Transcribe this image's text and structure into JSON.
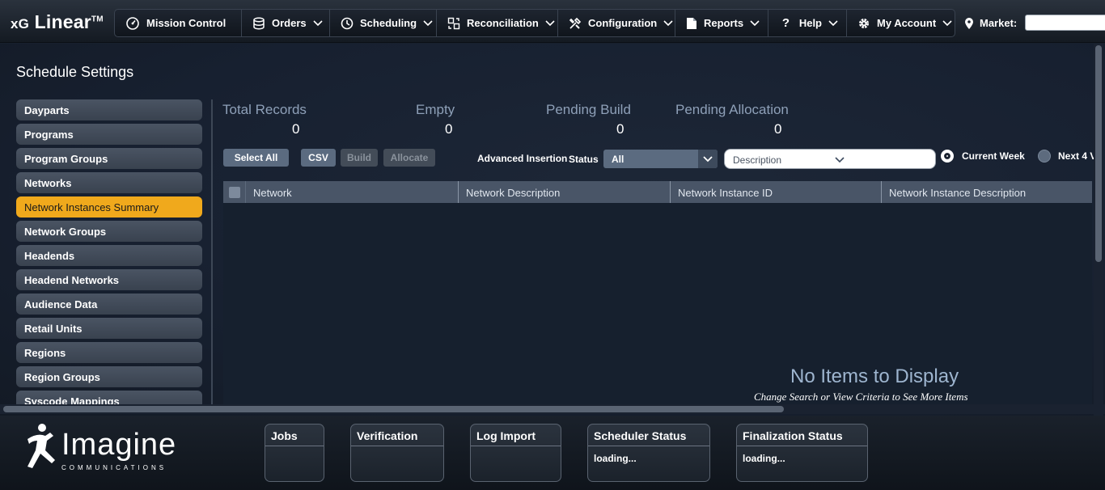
{
  "app": {
    "brand_prefix": "xG",
    "brand_name": "Linear",
    "brand_tm": "TM"
  },
  "nav": [
    {
      "label": "Mission Control",
      "icon": "dashboard-icon",
      "has_menu": false
    },
    {
      "label": "Orders",
      "icon": "database-icon",
      "has_menu": true
    },
    {
      "label": "Scheduling",
      "icon": "clock-icon",
      "has_menu": true
    },
    {
      "label": "Reconciliation",
      "icon": "reconcile-icon",
      "has_menu": true
    },
    {
      "label": "Configuration",
      "icon": "tools-icon",
      "has_menu": true
    },
    {
      "label": "Reports",
      "icon": "document-icon",
      "has_menu": true
    },
    {
      "label": "Help",
      "icon": "question-icon",
      "has_menu": true
    },
    {
      "label": "My Account",
      "icon": "gear-icon",
      "has_menu": true
    }
  ],
  "market": {
    "label": "Market:",
    "icon": "map-pin-icon",
    "value": ""
  },
  "page": {
    "title": "Schedule Settings"
  },
  "sidebar": {
    "items": [
      {
        "label": "Dayparts",
        "active": false
      },
      {
        "label": "Programs",
        "active": false
      },
      {
        "label": "Program Groups",
        "active": false
      },
      {
        "label": "Networks",
        "active": false
      },
      {
        "label": "Network Instances Summary",
        "active": true
      },
      {
        "label": "Network Groups",
        "active": false
      },
      {
        "label": "Headends",
        "active": false
      },
      {
        "label": "Headend Networks",
        "active": false
      },
      {
        "label": "Audience Data",
        "active": false
      },
      {
        "label": "Retail Units",
        "active": false
      },
      {
        "label": "Regions",
        "active": false
      },
      {
        "label": "Region Groups",
        "active": false
      },
      {
        "label": "Syscode Mappings",
        "active": false
      }
    ]
  },
  "stats": {
    "total_records": {
      "label": "Total Records",
      "value": "0"
    },
    "empty": {
      "label": "Empty",
      "value": "0"
    },
    "pending_build": {
      "label": "Pending Build",
      "value": "0"
    },
    "pending_allocation": {
      "label": "Pending Allocation",
      "value": "0"
    }
  },
  "toolbar": {
    "select_all": "Select All",
    "csv": "CSV",
    "build": "Build",
    "allocate": "Allocate",
    "advanced_insertion": "Advanced Insertion",
    "status_label": "Status",
    "status_value": "All",
    "description_placeholder": "Description",
    "current_week": "Current Week",
    "next_4_weeks": "Next 4 V"
  },
  "grid": {
    "columns": [
      "Network",
      "Network Description",
      "Network Instance ID",
      "Network Instance Description"
    ],
    "rows": [],
    "empty_title": "No Items to Display",
    "empty_subtitle": "Change Search or View Criteria to See More Items"
  },
  "footer": {
    "logo_word": "Imagine",
    "logo_sub": "COMMUNICATIONS",
    "widgets": [
      {
        "title": "Jobs",
        "body": ""
      },
      {
        "title": "Verification",
        "body": ""
      },
      {
        "title": "Log Import",
        "body": ""
      },
      {
        "title": "Scheduler Status",
        "body": "loading..."
      },
      {
        "title": "Finalization Status",
        "body": "loading..."
      }
    ]
  },
  "colors": {
    "accent": "#f0a91c",
    "background": "#17202d",
    "header_col": "#495567"
  }
}
